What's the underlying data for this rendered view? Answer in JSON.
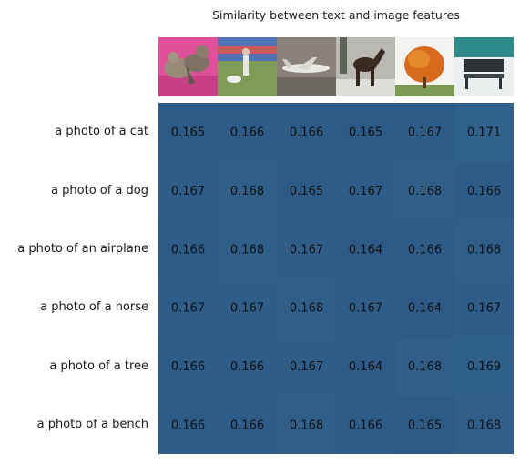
{
  "chart_data": {
    "type": "heatmap",
    "title": "Similarity between text and image features",
    "rows": [
      "a photo of a cat",
      "a photo of a dog",
      "a photo of an airplane",
      "a photo of a horse",
      "a photo of a tree",
      "a photo of a bench"
    ],
    "columns": [
      "cat-icon",
      "dog-icon",
      "airplane-icon",
      "horse-icon",
      "tree-icon",
      "bench-icon"
    ],
    "values": [
      [
        "0.165",
        "0.166",
        "0.166",
        "0.165",
        "0.167",
        "0.171"
      ],
      [
        "0.167",
        "0.168",
        "0.165",
        "0.167",
        "0.168",
        "0.166"
      ],
      [
        "0.166",
        "0.168",
        "0.167",
        "0.164",
        "0.166",
        "0.168"
      ],
      [
        "0.167",
        "0.167",
        "0.168",
        "0.167",
        "0.164",
        "0.167"
      ],
      [
        "0.166",
        "0.166",
        "0.167",
        "0.164",
        "0.168",
        "0.169"
      ],
      [
        "0.166",
        "0.166",
        "0.168",
        "0.166",
        "0.165",
        "0.168"
      ]
    ],
    "color_low": "#2d5a86",
    "color_high": "#30628c"
  }
}
